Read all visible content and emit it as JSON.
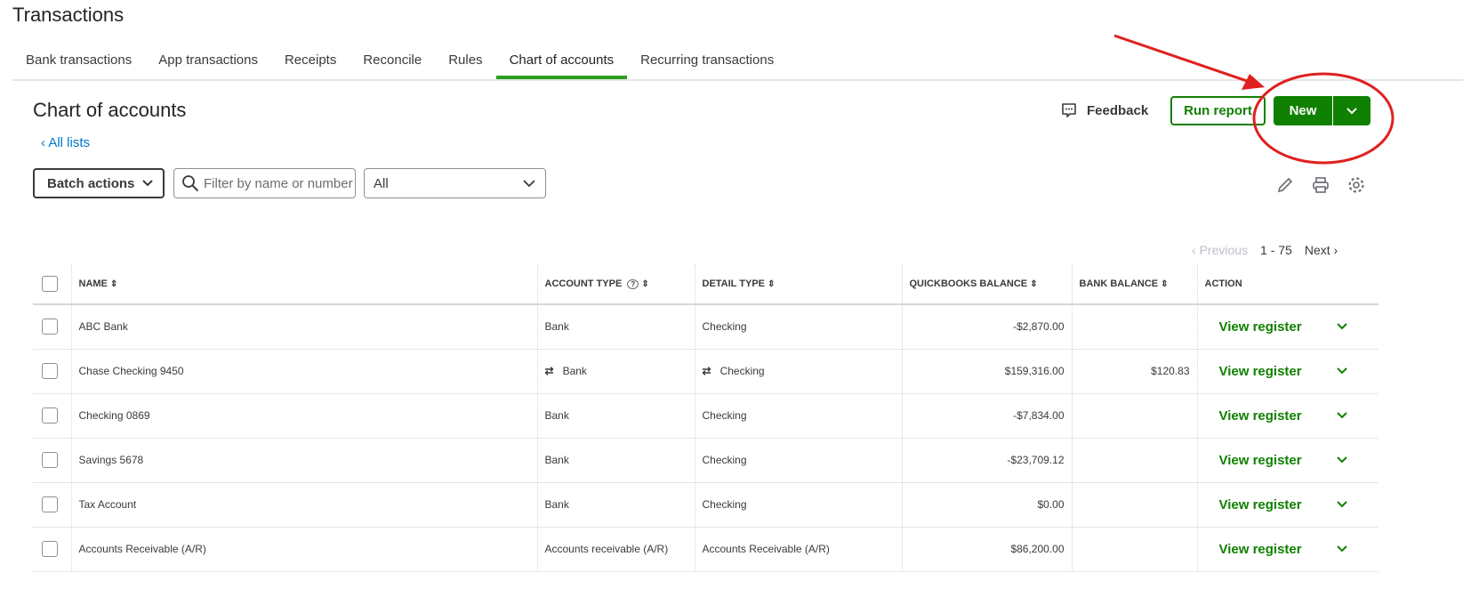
{
  "page_title": "Transactions",
  "tabs": [
    {
      "label": "Bank transactions"
    },
    {
      "label": "App transactions"
    },
    {
      "label": "Receipts"
    },
    {
      "label": "Reconcile"
    },
    {
      "label": "Rules"
    },
    {
      "label": "Chart of accounts",
      "active": true
    },
    {
      "label": "Recurring transactions"
    }
  ],
  "heading": "Chart of accounts",
  "back_link": "All lists",
  "feedback": "Feedback",
  "run_report": "Run report",
  "new": "New",
  "batch_actions": "Batch actions",
  "search_placeholder": "Filter by name or number",
  "filter_value": "All",
  "pager": {
    "previous": "Previous",
    "range": "1 - 75",
    "next": "Next"
  },
  "columns": {
    "name": "NAME",
    "account_type": "ACCOUNT TYPE",
    "detail_type": "DETAIL TYPE",
    "qb_balance": "QUICKBOOKS BALANCE",
    "bank_balance": "BANK BALANCE",
    "action": "ACTION"
  },
  "rows": [
    {
      "name": "ABC Bank",
      "account_type": "Bank",
      "detail_type": "Checking",
      "qb_balance": "-$2,870.00",
      "bank_balance": "",
      "action": "View register",
      "linked": false
    },
    {
      "name": "Chase Checking 9450",
      "account_type": "Bank",
      "detail_type": "Checking",
      "qb_balance": "$159,316.00",
      "bank_balance": "$120.83",
      "action": "View register",
      "linked": true
    },
    {
      "name": "Checking 0869",
      "account_type": "Bank",
      "detail_type": "Checking",
      "qb_balance": "-$7,834.00",
      "bank_balance": "",
      "action": "View register",
      "linked": false
    },
    {
      "name": "Savings 5678",
      "account_type": "Bank",
      "detail_type": "Checking",
      "qb_balance": "-$23,709.12",
      "bank_balance": "",
      "action": "View register",
      "linked": false
    },
    {
      "name": "Tax Account",
      "account_type": "Bank",
      "detail_type": "Checking",
      "qb_balance": "$0.00",
      "bank_balance": "",
      "action": "View register",
      "linked": false
    },
    {
      "name": "Accounts Receivable (A/R)",
      "account_type": "Accounts receivable (A/R)",
      "detail_type": "Accounts Receivable (A/R)",
      "qb_balance": "$86,200.00",
      "bank_balance": "",
      "action": "View register",
      "linked": false
    }
  ],
  "colors": {
    "brand_green": "#108000",
    "tab_accent": "#2ca01c",
    "annotation_red": "#e02020"
  }
}
